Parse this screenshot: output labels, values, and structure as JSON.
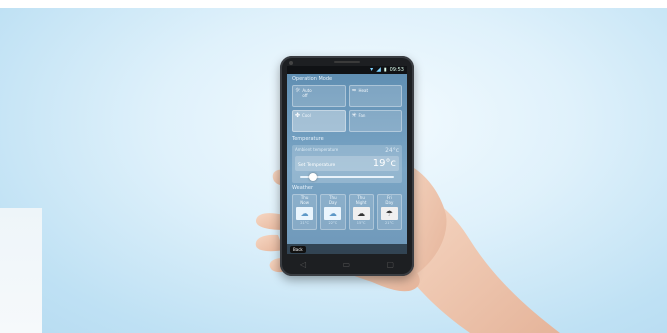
{
  "status": {
    "time": "09:53"
  },
  "operation_mode": {
    "title": "Operation Mode",
    "modes": [
      {
        "label": "Auto",
        "sub": "off",
        "icon": "auto-icon"
      },
      {
        "label": "Heat",
        "icon": "heat-icon"
      },
      {
        "label": "Cool",
        "icon": "fan-cool-icon"
      },
      {
        "label": "Fan",
        "icon": "snowflake-icon"
      }
    ]
  },
  "temperature": {
    "title": "Temperature",
    "ambient_label": "Ambient temperature",
    "ambient_value": "24°c",
    "set_label": "Set Temperature",
    "set_value": "19°c",
    "slider_level_percent": 10
  },
  "weather": {
    "title": "Weather",
    "days": [
      {
        "line1": "Thu",
        "line2": "Now",
        "icon": "cloud-icon",
        "temp": "21°C"
      },
      {
        "line1": "Thu",
        "line2": "Day",
        "icon": "cloud-icon",
        "temp": "22°C"
      },
      {
        "line1": "Thu",
        "line2": "Night",
        "icon": "cloud-outline-icon",
        "temp": "15°C"
      },
      {
        "line1": "Fri",
        "line2": "Day",
        "icon": "cloud-rain-icon",
        "temp": "21°C"
      }
    ]
  },
  "nav": {
    "back_label": "Back"
  }
}
